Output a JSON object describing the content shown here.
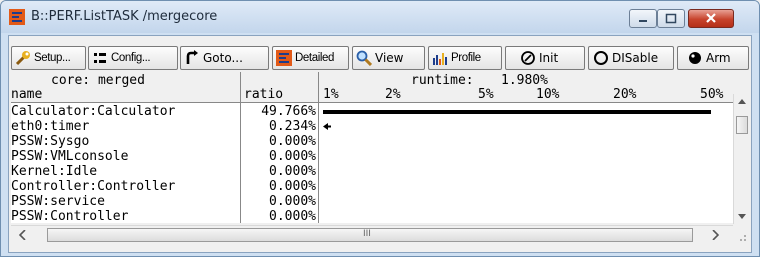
{
  "window": {
    "title": "B::PERF.ListTASK /mergecore"
  },
  "toolbar": {
    "setup": "Setup...",
    "config": "Config...",
    "goto": "Goto...",
    "detailed": "Detailed",
    "view": "View",
    "profile": "Profile",
    "init": "Init",
    "disable": "DISable",
    "arm": "Arm"
  },
  "header": {
    "core_label": "core: merged",
    "runtime_label": "runtime:",
    "runtime_value": "1.980%",
    "col_name": "name",
    "col_ratio": "ratio",
    "scale": [
      "1%",
      "2%",
      "5%",
      "10%",
      "20%",
      "50%"
    ]
  },
  "rows": [
    {
      "name": "Calculator:Calculator",
      "ratio": "49.766%",
      "fraction": 0.49766
    },
    {
      "name": "eth0:timer",
      "ratio": "0.234%",
      "fraction": 0.00234
    },
    {
      "name": "PSSW:Sysgo",
      "ratio": "0.000%",
      "fraction": 0
    },
    {
      "name": "PSSW:VMLconsole",
      "ratio": "0.000%",
      "fraction": 0
    },
    {
      "name": "Kernel:Idle",
      "ratio": "0.000%",
      "fraction": 0
    },
    {
      "name": "Controller:Controller",
      "ratio": "0.000%",
      "fraction": 0
    },
    {
      "name": "PSSW:service",
      "ratio": "0.000%",
      "fraction": 0
    },
    {
      "name": "PSSW:Controller",
      "ratio": "0.000%",
      "fraction": 0
    }
  ],
  "hscroll": {
    "grip": "III"
  }
}
